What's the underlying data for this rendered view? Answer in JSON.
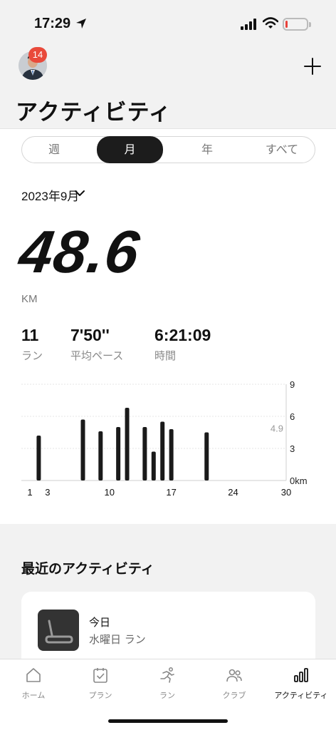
{
  "status_bar": {
    "time": "17:29",
    "battery_level": 0.12
  },
  "header": {
    "notification_count": "14",
    "title": "アクティビティ"
  },
  "segments": [
    {
      "label": "週",
      "active": false
    },
    {
      "label": "月",
      "active": true
    },
    {
      "label": "年",
      "active": false
    },
    {
      "label": "すべて",
      "active": false
    }
  ],
  "period": {
    "label": "2023年9月"
  },
  "summary": {
    "distance": "48.6",
    "unit": "KM",
    "stats": [
      {
        "value": "11",
        "label": "ラン"
      },
      {
        "value": "7'50''",
        "label": "平均ペース"
      },
      {
        "value": "6:21:09",
        "label": "時間"
      }
    ]
  },
  "chart_data": {
    "type": "bar",
    "x_tick_labels": [
      "1",
      "3",
      "10",
      "17",
      "24",
      "30"
    ],
    "x_ticks": [
      1,
      3,
      10,
      17,
      24,
      30
    ],
    "y_tick_labels": [
      "9",
      "6",
      "3",
      "0km"
    ],
    "y_ticks": [
      9,
      6,
      3,
      0
    ],
    "ylim": [
      0,
      9
    ],
    "xlim": [
      1,
      30
    ],
    "average_label": "4.9",
    "average": 4.9,
    "bars": [
      {
        "day": 2,
        "value": 4.2
      },
      {
        "day": 7,
        "value": 5.7
      },
      {
        "day": 9,
        "value": 4.6
      },
      {
        "day": 11,
        "value": 5.0
      },
      {
        "day": 12,
        "value": 6.8
      },
      {
        "day": 14,
        "value": 5.0
      },
      {
        "day": 15,
        "value": 2.7
      },
      {
        "day": 16,
        "value": 5.5
      },
      {
        "day": 17,
        "value": 4.8
      },
      {
        "day": 21,
        "value": 4.5
      }
    ],
    "bar_color": "#1a1a1a"
  },
  "recent": {
    "title": "最近のアクティビティ",
    "card": {
      "day": "今日",
      "subtitle": "水曜日 ラン"
    }
  },
  "tab_bar": {
    "tabs": [
      {
        "label": "ホーム",
        "icon": "home-icon",
        "active": false
      },
      {
        "label": "プラン",
        "icon": "plan-icon",
        "active": false
      },
      {
        "label": "ラン",
        "icon": "run-icon",
        "active": false
      },
      {
        "label": "クラブ",
        "icon": "club-icon",
        "active": false
      },
      {
        "label": "アクティビティ",
        "icon": "activity-icon",
        "active": true
      }
    ]
  },
  "colors": {
    "badge": "#e94a3b",
    "battery_low": "#e8413a",
    "active_segment": "#1c1c1c"
  }
}
